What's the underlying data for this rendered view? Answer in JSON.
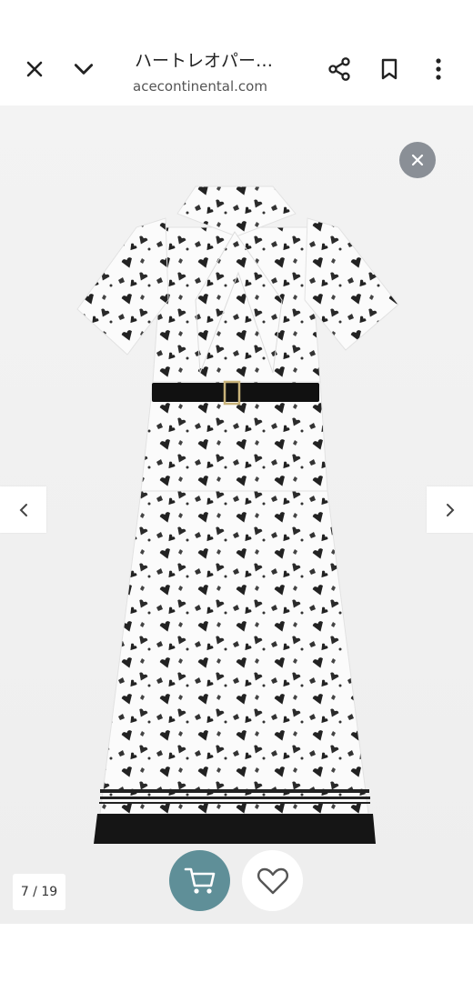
{
  "header": {
    "title": "ハートレオパー…",
    "url": "acecontinental.com",
    "icons": [
      "close-icon",
      "chevron-down-icon",
      "share-icon",
      "bookmark-icon",
      "more-vert-icon"
    ]
  },
  "gallery": {
    "counter": "7 / 19",
    "accent_color": "#5f8f98",
    "close_button_color": "#8a8f96"
  },
  "actions": {
    "cart_icon": "cart-icon",
    "favorite_icon": "heart-icon"
  }
}
